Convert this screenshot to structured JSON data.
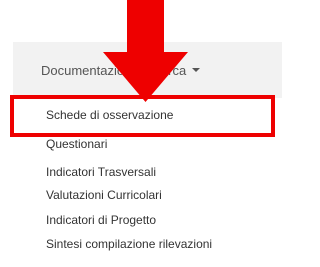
{
  "navbar": {
    "dropdown_label": "Documentazione Ricerca",
    "caret_icon": "caret-down-icon"
  },
  "menu": {
    "items": [
      {
        "label": "Schede di osservazione",
        "highlighted": true
      },
      {
        "label": "Questionari"
      },
      {
        "label": "Indicatori Trasversali"
      },
      {
        "label": "Valutazioni Curricolari"
      },
      {
        "label": "Indicatori di Progetto"
      },
      {
        "label": "Sintesi compilazione rilevazioni"
      }
    ]
  },
  "annotation": {
    "arrow_icon": "down-arrow-icon",
    "color": "#ee0000"
  }
}
